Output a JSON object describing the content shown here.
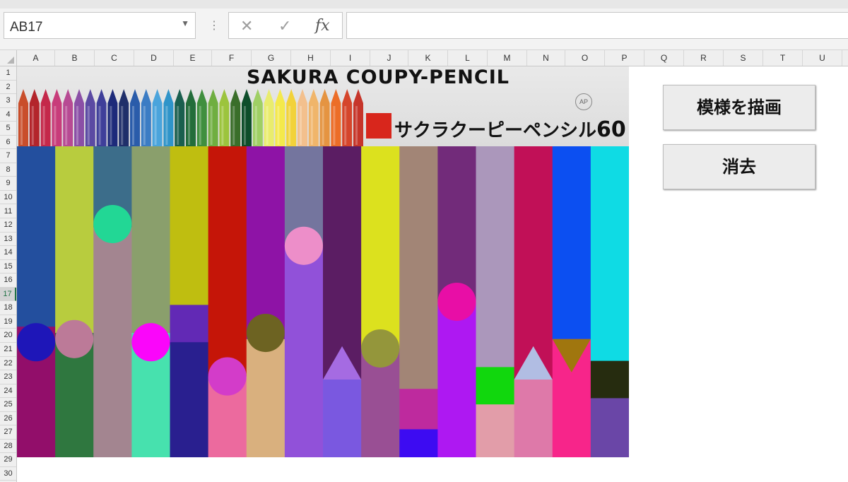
{
  "namebox": {
    "value": "AB17"
  },
  "formula_bar": {
    "cancel_icon": "cancel-icon",
    "enter_icon": "check-icon",
    "fx_label": "fx",
    "value": ""
  },
  "columns": [
    "A",
    "B",
    "C",
    "D",
    "E",
    "F",
    "G",
    "H",
    "I",
    "J",
    "K",
    "L",
    "M",
    "N",
    "O",
    "P",
    "Q",
    "R",
    "S",
    "T",
    "U"
  ],
  "rows": [
    "1",
    "2",
    "3",
    "4",
    "5",
    "6",
    "7",
    "8",
    "9",
    "10",
    "11",
    "12",
    "13",
    "14",
    "15",
    "16",
    "17",
    "18",
    "19",
    "20",
    "21",
    "22",
    "23",
    "24",
    "25",
    "26",
    "27",
    "28",
    "29",
    "30"
  ],
  "selected_row": "17",
  "banner": {
    "brand": "SAKURA COUPY-PENCIL",
    "jp_brand": "サクラクーピーペンシル",
    "count": "60",
    "ap_mark": "AP",
    "pencil_colors": [
      "#c94e2b",
      "#b3252b",
      "#c4284a",
      "#c83c7a",
      "#b74a93",
      "#8b4fa6",
      "#5b4aa3",
      "#3f3f9a",
      "#1d2a7a",
      "#1f2f6a",
      "#2a5caa",
      "#3b7cc4",
      "#4aa4dc",
      "#2f94c9",
      "#1a5f4e",
      "#236d3a",
      "#3f8f3e",
      "#6fae40",
      "#9cc43d",
      "#3a6e2a",
      "#0e4e2a",
      "#9fcf64",
      "#e9ec6d",
      "#f4e94b",
      "#f2d23a",
      "#f3c08d",
      "#f0b56a",
      "#e59441",
      "#ec6d27",
      "#d5452b",
      "#c6352a"
    ]
  },
  "buttons": {
    "draw": "模様を描画",
    "clear": "消去"
  },
  "pattern": [
    {
      "bg": "#234f9e",
      "segments": [
        {
          "h": 0.58,
          "c": "#234f9e"
        },
        {
          "h": 0.42,
          "c": "#920e6a"
        }
      ],
      "shape": {
        "type": "circle",
        "c": "#1e16b8",
        "pos": 0.63
      }
    },
    {
      "bg": "#b8cc3e",
      "segments": [
        {
          "h": 0.6,
          "c": "#b8cc3e"
        },
        {
          "h": 0.4,
          "c": "#2f773f"
        }
      ],
      "shape": {
        "type": "circle",
        "c": "#bc7a98",
        "pos": 0.62
      }
    },
    {
      "bg": "#3c6d8a",
      "segments": [
        {
          "h": 0.26,
          "c": "#3c6d8a"
        },
        {
          "h": 0.74,
          "c": "#a38590"
        }
      ],
      "shape": {
        "type": "circle",
        "c": "#22d795",
        "pos": 0.25
      }
    },
    {
      "bg": "#8a9f6c",
      "segments": [
        {
          "h": 0.6,
          "c": "#8a9f6c"
        },
        {
          "h": 0.4,
          "c": "#47e1ae"
        }
      ],
      "shape": {
        "type": "circle",
        "c": "#fa06fa",
        "pos": 0.63
      }
    },
    {
      "bg": "#bfbe10",
      "segments": [
        {
          "h": 0.51,
          "c": "#bfbe10"
        },
        {
          "h": 0.12,
          "c": "#6229b5"
        },
        {
          "h": 0.37,
          "c": "#291f8f"
        }
      ],
      "shape": null
    },
    {
      "bg": "#c51508",
      "segments": [
        {
          "h": 0.74,
          "c": "#c51508"
        },
        {
          "h": 0.26,
          "c": "#ec6a9e"
        }
      ],
      "shape": {
        "type": "circle",
        "c": "#d33cc9",
        "pos": 0.74
      }
    },
    {
      "bg": "#8e13a6",
      "segments": [
        {
          "h": 0.62,
          "c": "#8e13a6"
        },
        {
          "h": 0.38,
          "c": "#d9b07e"
        }
      ],
      "shape": {
        "type": "circle",
        "c": "#6d6322",
        "pos": 0.6
      }
    },
    {
      "bg": "#74759e",
      "segments": [
        {
          "h": 0.32,
          "c": "#74759e"
        },
        {
          "h": 0.68,
          "c": "#9151d9"
        }
      ],
      "shape": {
        "type": "circle",
        "c": "#ed8ec9",
        "pos": 0.32
      }
    },
    {
      "bg": "#5b1d63",
      "segments": [
        {
          "h": 0.75,
          "c": "#5b1d63"
        },
        {
          "h": 0.25,
          "c": "#7a58e0"
        }
      ],
      "shape": {
        "type": "triangle-up",
        "c": "#a56be2",
        "pos": 0.75
      }
    },
    {
      "bg": "#dce11e",
      "segments": [
        {
          "h": 0.65,
          "c": "#dce11e"
        },
        {
          "h": 0.35,
          "c": "#994f94"
        }
      ],
      "shape": {
        "type": "circle",
        "c": "#94963b",
        "pos": 0.65
      }
    },
    {
      "bg": "#a28576",
      "segments": [
        {
          "h": 0.78,
          "c": "#a28576"
        },
        {
          "h": 0.13,
          "c": "#be2a9e"
        },
        {
          "h": 0.09,
          "c": "#3d0bf2"
        }
      ],
      "shape": null
    },
    {
      "bg": "#722b7a",
      "segments": [
        {
          "h": 0.5,
          "c": "#722b7a"
        },
        {
          "h": 0.5,
          "c": "#ae18f2"
        }
      ],
      "shape": {
        "type": "circle",
        "c": "#e80ea6",
        "pos": 0.5
      }
    },
    {
      "bg": "#ab97bb",
      "segments": [
        {
          "h": 0.71,
          "c": "#ab97bb"
        },
        {
          "h": 0.12,
          "c": "#11d70d"
        },
        {
          "h": 0.17,
          "c": "#e29da9"
        }
      ],
      "shape": null
    },
    {
      "bg": "#c11057",
      "segments": [
        {
          "h": 0.75,
          "c": "#c11057"
        },
        {
          "h": 0.25,
          "c": "#de79a9"
        }
      ],
      "shape": {
        "type": "triangle-up",
        "c": "#b1bde3",
        "pos": 0.75
      }
    },
    {
      "bg": "#0c4ff1",
      "segments": [
        {
          "h": 0.62,
          "c": "#0c4ff1"
        },
        {
          "h": 0.38,
          "c": "#f7258a"
        }
      ],
      "shape": {
        "type": "triangle-down",
        "c": "#a0760e",
        "pos": 0.62
      }
    },
    {
      "bg": "#0fdbe4",
      "segments": [
        {
          "h": 0.69,
          "c": "#0fdbe4"
        },
        {
          "h": 0.12,
          "c": "#262c0f"
        },
        {
          "h": 0.19,
          "c": "#6a46a7"
        }
      ],
      "shape": null
    }
  ]
}
